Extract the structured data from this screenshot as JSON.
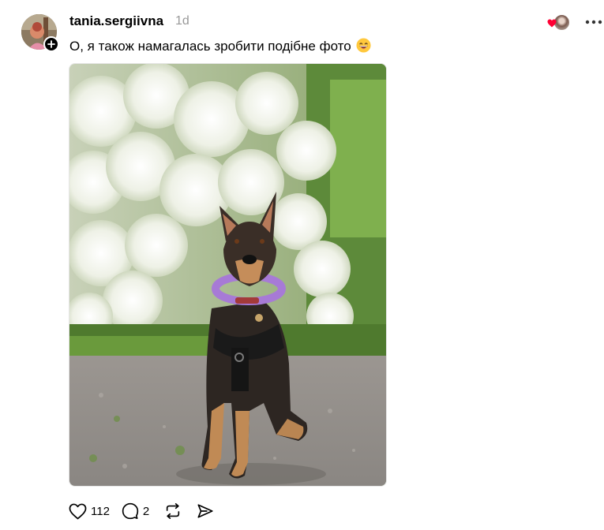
{
  "post": {
    "username": "tania.sergiivna",
    "timestamp": "1d",
    "text": "О, я також намагалась зробити подібне фото",
    "emoji": "grinning-face-emoji",
    "image_alt": "German shepherd dog with purple collar sitting in front of a flowering white bush",
    "liked_by_avatar": "user-avatar",
    "actions": {
      "like_count": "112",
      "reply_count": "2"
    }
  },
  "icons": {
    "like": "heart-icon",
    "reply": "comment-bubble-icon",
    "repost": "repost-icon",
    "share": "send-icon",
    "more": "more-horizontal-icon",
    "follow": "plus-icon"
  },
  "colors": {
    "accent_heart": "#ff0034",
    "muted_text": "#999999",
    "collar_purple": "#a77ad6"
  }
}
